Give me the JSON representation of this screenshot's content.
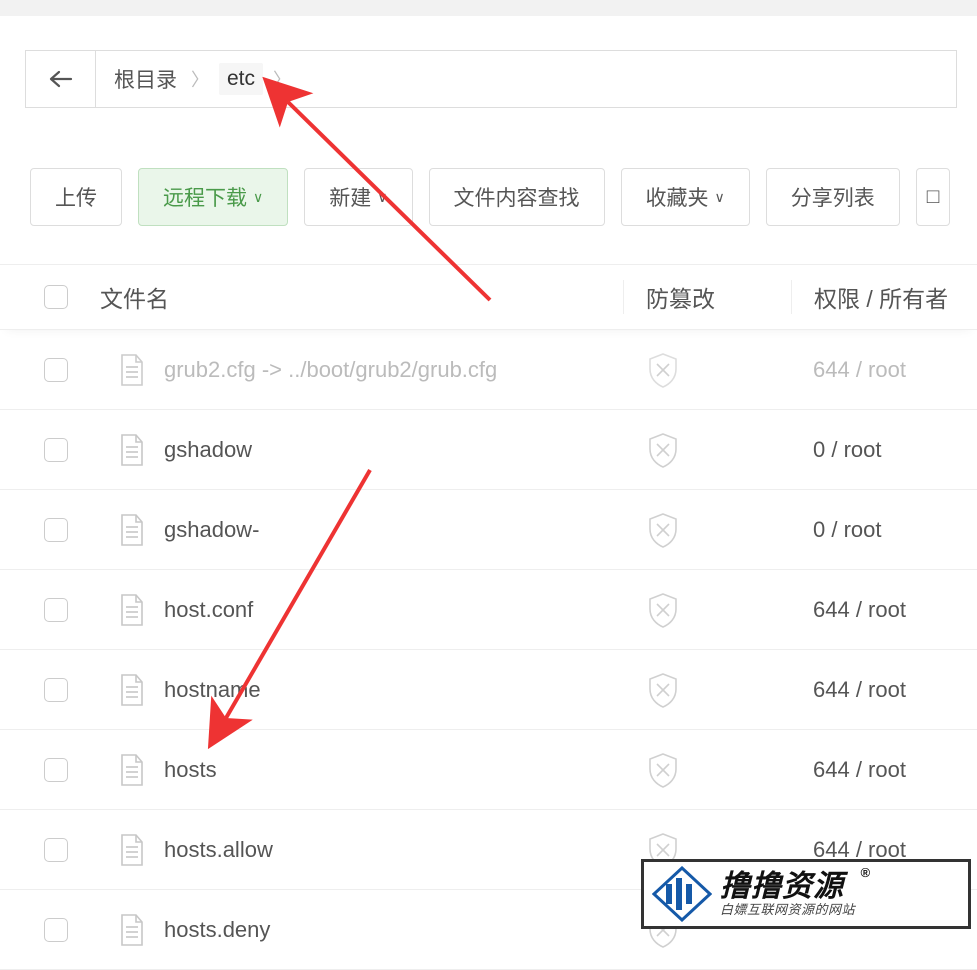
{
  "breadcrumb": {
    "root_label": "根目录",
    "current_label": "etc"
  },
  "toolbar": {
    "upload": "上传",
    "remote_download": "远程下载",
    "new": "新建",
    "content_search": "文件内容查找",
    "favorites": "收藏夹",
    "share_list": "分享列表"
  },
  "columns": {
    "name": "文件名",
    "tamper": "防篡改",
    "perm": "权限 / 所有者"
  },
  "rows": [
    {
      "name": "grub2.cfg -> ../boot/grub2/grub.cfg",
      "perm": "644 / root",
      "faded": true
    },
    {
      "name": "gshadow",
      "perm": "0 / root",
      "faded": false
    },
    {
      "name": "gshadow-",
      "perm": "0 / root",
      "faded": false
    },
    {
      "name": "host.conf",
      "perm": "644 / root",
      "faded": false
    },
    {
      "name": "hostname",
      "perm": "644 / root",
      "faded": false
    },
    {
      "name": "hosts",
      "perm": "644 / root",
      "faded": false
    },
    {
      "name": "hosts.allow",
      "perm": "644 / root",
      "faded": false
    },
    {
      "name": "hosts.deny",
      "perm": "",
      "faded": false
    }
  ],
  "watermark": {
    "title": "撸撸资源",
    "reg": "®",
    "sub": "白嫖互联网资源的网站"
  }
}
